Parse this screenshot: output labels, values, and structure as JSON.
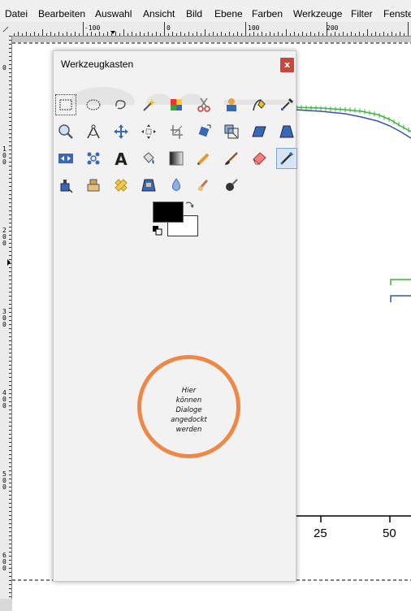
{
  "menubar": {
    "items": [
      {
        "label": "Datei",
        "underline": "D",
        "rest": "atei"
      },
      {
        "label": "Bearbeiten",
        "underline": "B",
        "rest": "earbeiten"
      },
      {
        "label": "Auswahl",
        "underline": "A",
        "rest": "uswahl"
      },
      {
        "label": "Ansicht",
        "underline": "",
        "rest": "Ansicht"
      },
      {
        "label": "Bild",
        "underline": "B",
        "rest": "ild"
      },
      {
        "label": "Ebene",
        "underline": "E",
        "rest": "bene"
      },
      {
        "label": "Farben",
        "underline": "F",
        "rest": "arben"
      },
      {
        "label": "Werkzeuge",
        "underline": "W",
        "rest": "erkzeuge"
      },
      {
        "label": "Filter",
        "underline": "",
        "rest": "Filter"
      },
      {
        "label": "Fenste",
        "underline": "F",
        "rest": "enste"
      }
    ]
  },
  "hruler": {
    "labels": [
      "-100",
      "0",
      "100",
      "200"
    ]
  },
  "vruler": {
    "labels": [
      "0",
      "1\n0\n0",
      "2\n0\n0",
      "3\n0\n0",
      "4\n0\n0",
      "5\n0\n0",
      "6\n0\n0"
    ]
  },
  "toolbox": {
    "title": "Werkzeugkasten",
    "close_label": "x",
    "dock_hint": [
      "Hier",
      "können",
      "Dialoge",
      "angedockt",
      "werden"
    ],
    "tools": [
      "rect-select",
      "ellipse-select",
      "free-select",
      "fuzzy-select",
      "color-select",
      "scissors-select",
      "foreground-select",
      "paths",
      "color-picker",
      "zoom",
      "measure",
      "move",
      "align",
      "crop",
      "rotate",
      "scale",
      "shear",
      "perspective",
      "flip",
      "cage-transform",
      "text",
      "bucket-fill",
      "blend",
      "pencil",
      "paintbrush",
      "eraser",
      "airbrush",
      "ink",
      "clone",
      "heal",
      "perspective-clone",
      "blur",
      "smudge",
      "dodge-burn"
    ],
    "active_tool": "airbrush",
    "fg_color": "#000000",
    "bg_color": "#ffffff"
  },
  "canvas": {
    "x_ticks": [
      "25",
      "50"
    ],
    "series_colors": {
      "green": "#3cb43c",
      "blue": "#3c50b4"
    }
  }
}
